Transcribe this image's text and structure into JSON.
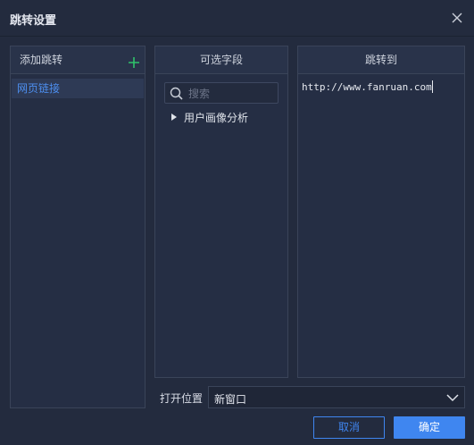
{
  "dialog": {
    "title": "跳转设置"
  },
  "left_panel": {
    "header": "添加跳转",
    "items": [
      {
        "label": "网页链接"
      }
    ]
  },
  "middle_panel": {
    "header": "可选字段",
    "search": {
      "placeholder": "搜索",
      "value": ""
    },
    "tree": [
      {
        "label": "用户画像分析"
      }
    ]
  },
  "right_panel": {
    "header": "跳转到",
    "url": "http://www.fanruan.com"
  },
  "open_position": {
    "label": "打开位置",
    "selected": "新窗口"
  },
  "buttons": {
    "cancel": "取消",
    "confirm": "确定"
  },
  "colors": {
    "accent": "#3f86f0",
    "add_icon": "#2fc26b",
    "background": "#232b3e"
  }
}
